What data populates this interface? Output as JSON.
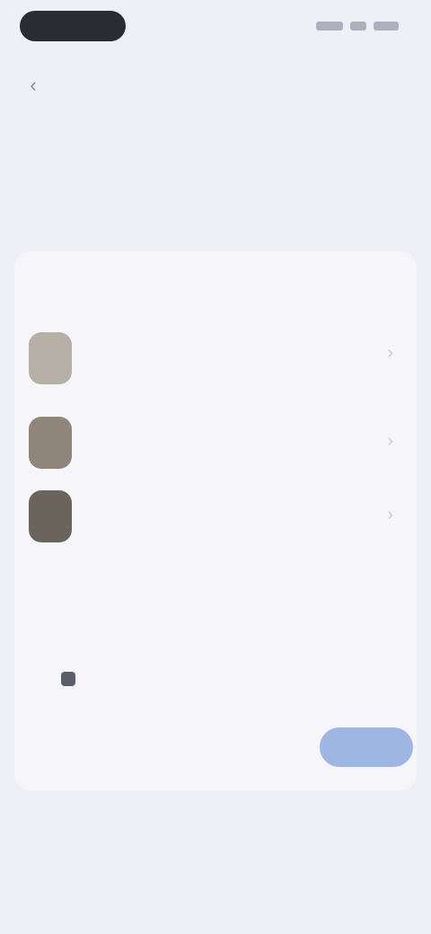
{
  "header": {
    "title": "",
    "action": ""
  },
  "notice": "",
  "link_text": "",
  "card": {
    "heading": "",
    "entries": [
      {
        "title": "",
        "meta": "",
        "thumb_color": "#b7b0a6"
      },
      {
        "title": "",
        "meta": "",
        "thumb_color": "#8f857a"
      },
      {
        "title": "",
        "meta": "",
        "thumb_color": "#6b645c"
      }
    ],
    "section_one": {
      "label": "",
      "link": "",
      "row_left": "",
      "row_mid": "",
      "row_right": ""
    },
    "section_two": {
      "label": "",
      "checkbox_label": ""
    }
  },
  "footer": {
    "cancel_label": "",
    "confirm_label": ""
  },
  "colors": {
    "accent": "#9fb6e4",
    "background": "#eef0f6",
    "card": "#f6f6fa"
  },
  "icons": {
    "back": "arrow-left-icon",
    "chevron": "chevron-right-icon"
  }
}
